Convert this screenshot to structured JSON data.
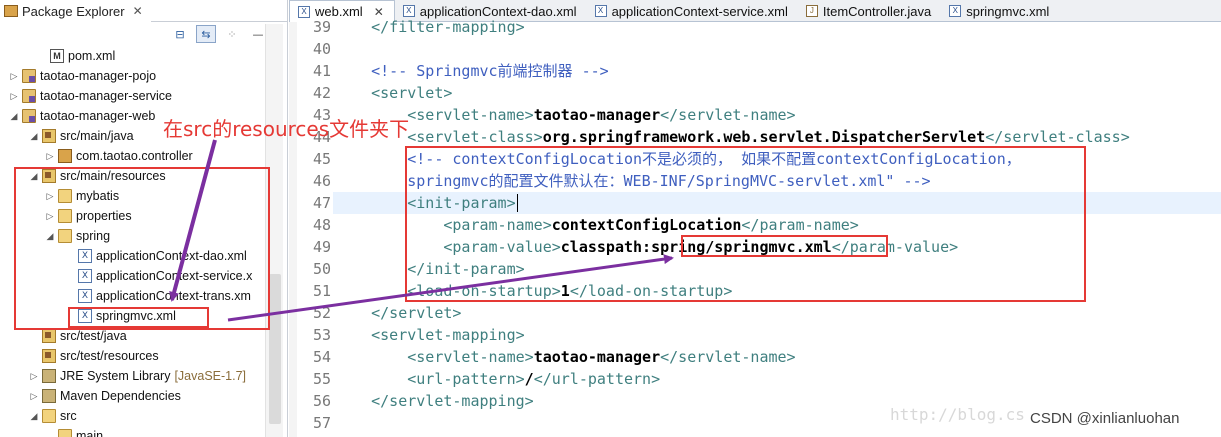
{
  "explorer": {
    "title": "Package Explorer",
    "close": "✕",
    "items": [
      {
        "label": "pom.xml",
        "icon": "pom-xml-icon",
        "arrow": ""
      },
      {
        "label": "taotao-manager-pojo",
        "icon": "project-icon",
        "arrow": "▷"
      },
      {
        "label": "taotao-manager-service",
        "icon": "project-icon",
        "arrow": "▷"
      },
      {
        "label": "taotao-manager-web",
        "icon": "project-icon",
        "arrow": "◢"
      },
      {
        "label": "src/main/java",
        "icon": "source-folder-icon",
        "arrow": "◢"
      },
      {
        "label": "com.taotao.controller",
        "icon": "package-icon",
        "arrow": "▷"
      },
      {
        "label": "src/main/resources",
        "icon": "source-folder-icon",
        "arrow": "◢"
      },
      {
        "label": "mybatis",
        "icon": "folder-icon",
        "arrow": "▷"
      },
      {
        "label": "properties",
        "icon": "folder-icon",
        "arrow": "▷"
      },
      {
        "label": "spring",
        "icon": "folder-icon",
        "arrow": "◢"
      },
      {
        "label": "applicationContext-dao.xml",
        "icon": "xml-file-icon",
        "arrow": ""
      },
      {
        "label": "applicationContext-service.x",
        "icon": "xml-file-icon",
        "arrow": ""
      },
      {
        "label": "applicationContext-trans.xm",
        "icon": "xml-file-icon",
        "arrow": ""
      },
      {
        "label": "springmvc.xml",
        "icon": "xml-file-icon",
        "arrow": ""
      },
      {
        "label": "src/test/java",
        "icon": "source-folder-icon",
        "arrow": ""
      },
      {
        "label": "src/test/resources",
        "icon": "source-folder-icon",
        "arrow": ""
      },
      {
        "label": "JRE System Library",
        "icon": "library-icon",
        "arrow": "▷"
      },
      {
        "label": "Maven Dependencies",
        "icon": "library-icon",
        "arrow": "▷"
      },
      {
        "label": "src",
        "icon": "folder-icon",
        "arrow": "◢"
      },
      {
        "label": "main",
        "icon": "folder-icon",
        "arrow": ""
      }
    ],
    "jre_version": "[JavaSE-1.7]"
  },
  "editor": {
    "tabs": [
      {
        "label": "web.xml",
        "icon": "X",
        "active": true,
        "close": "✕"
      },
      {
        "label": "applicationContext-dao.xml",
        "icon": "X",
        "active": false
      },
      {
        "label": "applicationContext-service.xml",
        "icon": "X",
        "active": false
      },
      {
        "label": "ItemController.java",
        "icon": "J",
        "active": false
      },
      {
        "label": "springmvc.xml",
        "icon": "X",
        "active": false
      }
    ],
    "lines": [
      {
        "num": "39",
        "segments": [
          {
            "t": "    </filter-mapping>",
            "k": "tag"
          }
        ]
      },
      {
        "num": "40",
        "segments": []
      },
      {
        "num": "41",
        "segments": [
          {
            "t": "    <!-- Springmvc前端控制器 -->",
            "k": "comment"
          }
        ]
      },
      {
        "num": "42",
        "segments": [
          {
            "t": "    <servlet>",
            "k": "tag"
          }
        ]
      },
      {
        "num": "43",
        "segments": [
          {
            "t": "        <servlet-name>",
            "k": "tag"
          },
          {
            "t": "taotao-manager",
            "k": "text"
          },
          {
            "t": "</servlet-name>",
            "k": "tag"
          }
        ]
      },
      {
        "num": "44",
        "segments": [
          {
            "t": "        <servlet-class>",
            "k": "tag"
          },
          {
            "t": "org.springframework.web.servlet.DispatcherServlet",
            "k": "text"
          },
          {
            "t": "</servlet-class>",
            "k": "tag"
          }
        ]
      },
      {
        "num": "45",
        "segments": [
          {
            "t": "        <!-- contextConfigLocation不是必须的， 如果不配置contextConfigLocation，",
            "k": "comment"
          }
        ]
      },
      {
        "num": "46",
        "segments": [
          {
            "t": "        springmvc的配置文件默认在：WEB-INF/SpringMVC-servlet.xml\" -->",
            "k": "comment"
          }
        ]
      },
      {
        "num": "47",
        "segments": [
          {
            "t": "        <init-param>",
            "k": "tag"
          }
        ]
      },
      {
        "num": "48",
        "segments": [
          {
            "t": "            <param-name>",
            "k": "tag"
          },
          {
            "t": "contextConfigLocation",
            "k": "text"
          },
          {
            "t": "</param-name>",
            "k": "tag"
          }
        ]
      },
      {
        "num": "49",
        "segments": [
          {
            "t": "            <param-value>",
            "k": "tag"
          },
          {
            "t": "classpath:spring/springmvc.xml",
            "k": "text"
          },
          {
            "t": "</param-value>",
            "k": "tag"
          }
        ]
      },
      {
        "num": "50",
        "segments": [
          {
            "t": "        </init-param>",
            "k": "tag"
          }
        ]
      },
      {
        "num": "51",
        "segments": [
          {
            "t": "        <load-on-startup>",
            "k": "tag"
          },
          {
            "t": "1",
            "k": "text"
          },
          {
            "t": "</load-on-startup>",
            "k": "tag"
          }
        ]
      },
      {
        "num": "52",
        "segments": [
          {
            "t": "    </servlet>",
            "k": "tag"
          }
        ]
      },
      {
        "num": "53",
        "segments": [
          {
            "t": "    <servlet-mapping>",
            "k": "tag"
          }
        ]
      },
      {
        "num": "54",
        "segments": [
          {
            "t": "        <servlet-name>",
            "k": "tag"
          },
          {
            "t": "taotao-manager",
            "k": "text"
          },
          {
            "t": "</servlet-name>",
            "k": "tag"
          }
        ]
      },
      {
        "num": "55",
        "segments": [
          {
            "t": "        <url-pattern>",
            "k": "tag"
          },
          {
            "t": "/",
            "k": "text"
          },
          {
            "t": "</url-pattern>",
            "k": "tag"
          }
        ]
      },
      {
        "num": "56",
        "segments": [
          {
            "t": "    </servlet-mapping>",
            "k": "tag"
          }
        ]
      },
      {
        "num": "57",
        "segments": []
      }
    ]
  },
  "annotation": {
    "text": "在src的resources文件夹下"
  },
  "watermark": {
    "blog": "http://blog.cs",
    "csdn": "CSDN @xinlianluohan"
  },
  "colors": {
    "annotation_red": "#e53935",
    "arrow_purple": "#7b2fa0",
    "xml_tag": "#3f7f7f",
    "xml_comment": "#3f5fbf"
  }
}
